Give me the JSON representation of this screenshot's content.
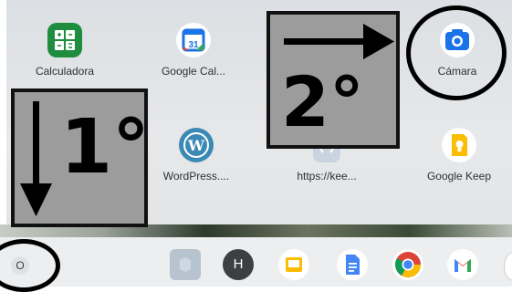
{
  "apps": [
    {
      "label": "Calculadora",
      "icon": "calculator-icon"
    },
    {
      "label": "Google Cal...",
      "icon": "calendar-icon",
      "icon_text": "31"
    },
    {
      "label": "Cámara",
      "icon": "camera-icon"
    },
    {
      "label": "WordPress....",
      "icon": "wordpress-icon",
      "icon_text": "W"
    },
    {
      "label": "https://kee...",
      "icon": "web-app-icon"
    },
    {
      "label": "Google Keep",
      "icon": "keep-icon"
    }
  ],
  "annotations": {
    "step1": "1°",
    "step2": "2°"
  },
  "shelf": {
    "launcher_glyph": "O",
    "avatar_letter": "H",
    "items": [
      "launcher-button",
      "app-icon",
      "profile-avatar",
      "slides-icon",
      "docs-icon",
      "chrome-icon",
      "gmail-icon"
    ]
  },
  "colors": {
    "calculator": "#1e8e3e",
    "calendar": "#1a73e8",
    "camera": "#1a73e8",
    "wordpress": "#3b8ab5",
    "keep": "#fbbc04",
    "annotation_box": "#9c9c9c"
  }
}
